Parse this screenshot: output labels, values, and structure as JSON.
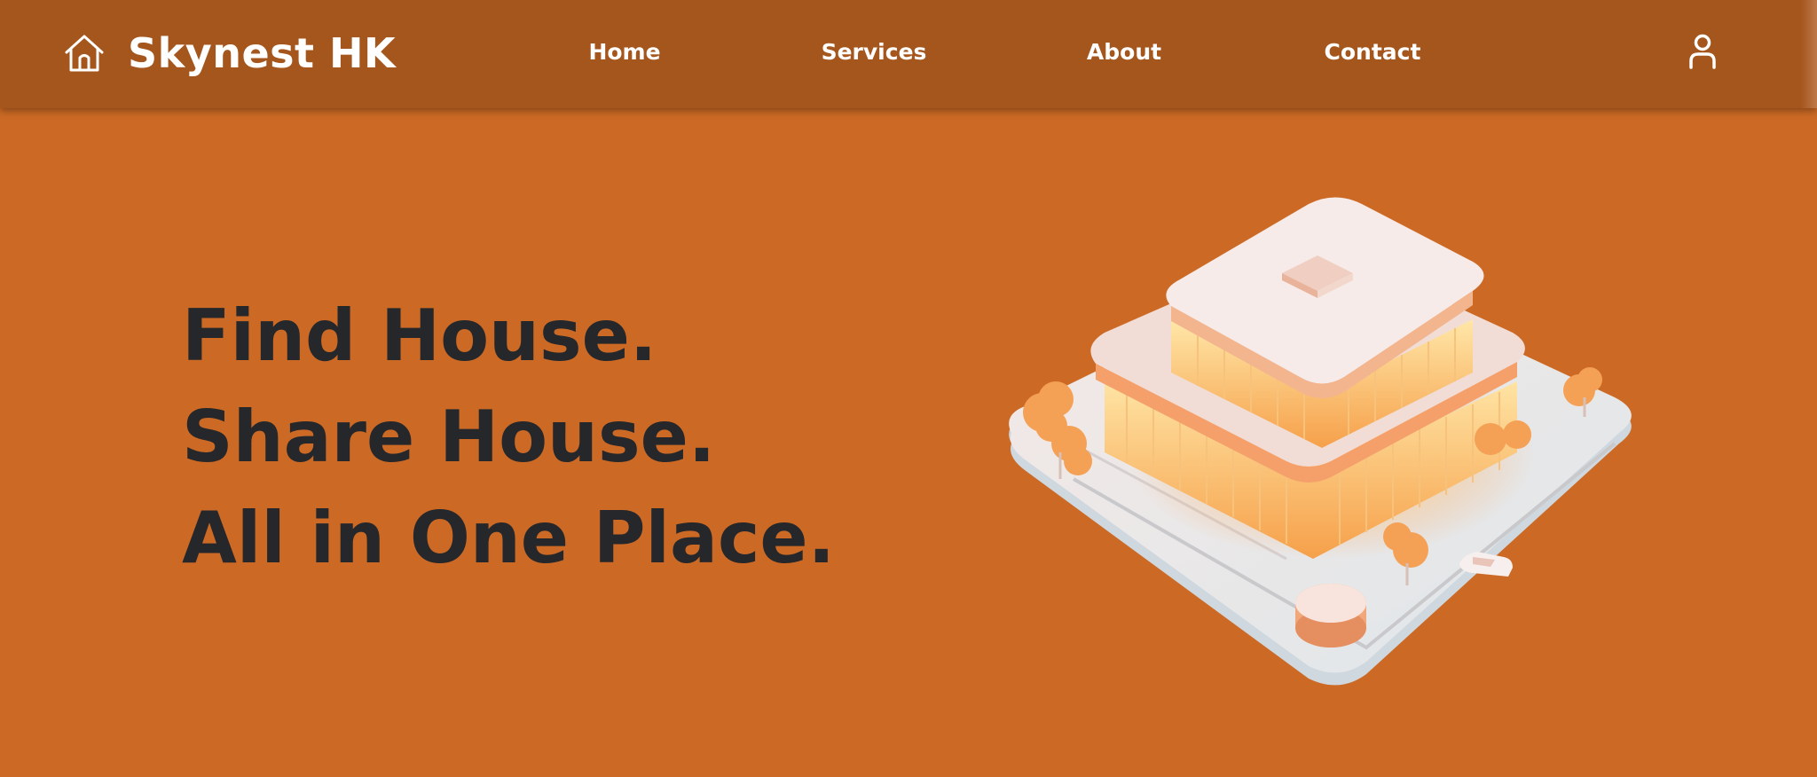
{
  "header": {
    "brand": {
      "name": "Skynest HK",
      "icon": "home-icon"
    },
    "nav": [
      {
        "label": "Home"
      },
      {
        "label": "Services"
      },
      {
        "label": "About"
      },
      {
        "label": "Contact"
      }
    ],
    "user_icon": "user-icon"
  },
  "hero": {
    "lines": [
      "Find House.",
      "Share House.",
      "All in One Place."
    ],
    "illustration": "isometric-building-illustration"
  },
  "colors": {
    "nav_background": "#a5561d",
    "page_background": "#cc6a25",
    "heading_text": "#25272b",
    "nav_text": "#ffffff"
  }
}
